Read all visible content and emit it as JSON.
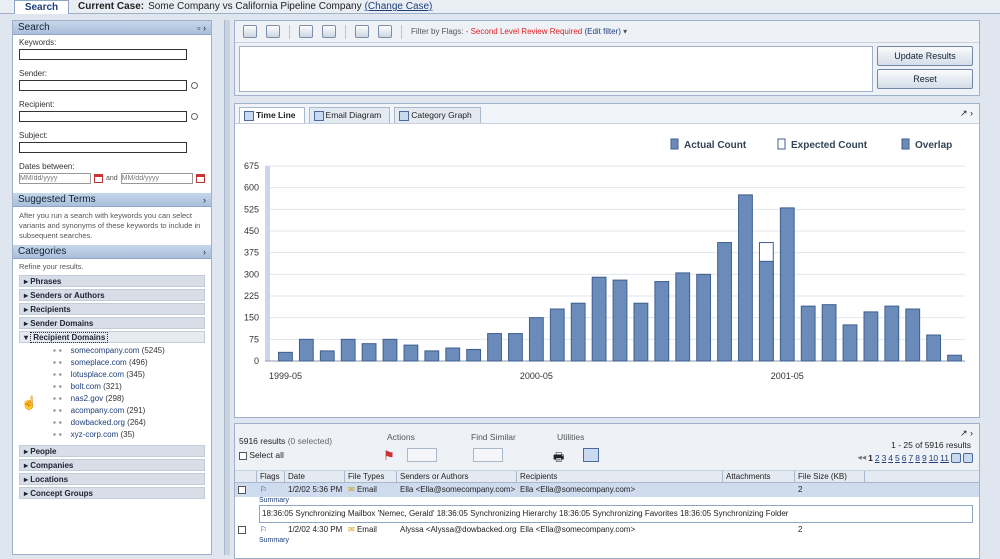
{
  "topbar": {
    "tab_search": "Search",
    "case_label": "Current Case:",
    "case_name": "Some Company vs California Pipeline Company",
    "change_case": "(Change Case)"
  },
  "search": {
    "title": "Search",
    "keywords_label": "Keywords:",
    "sender_label": "Sender:",
    "recipient_label": "Recipient:",
    "subject_label": "Subject:",
    "dates_label": "Dates between:",
    "date_placeholder": "MM/dd/yyyy",
    "and_label": "and"
  },
  "suggested": {
    "title": "Suggested Terms",
    "help": "After you run a search with keywords you can select variants and synonyms of these keywords to include in subsequent searches."
  },
  "categories": {
    "title": "Categories",
    "refine": "Refine your results.",
    "items": [
      "Phrases",
      "Senders or Authors",
      "Recipients",
      "Sender Domains",
      "Recipient Domains"
    ],
    "domains": [
      {
        "name": "somecompany.com",
        "count": "(5245)"
      },
      {
        "name": "someplace.com",
        "count": "(496)"
      },
      {
        "name": "lotusplace.com",
        "count": "(345)"
      },
      {
        "name": "bolt.com",
        "count": "(321)"
      },
      {
        "name": "nas2.gov",
        "count": "(298)"
      },
      {
        "name": "acompany.com",
        "count": "(291)"
      },
      {
        "name": "dowbacked.org",
        "count": "(264)"
      },
      {
        "name": "xyz-corp.com",
        "count": "(35)"
      }
    ],
    "bottom_items": [
      "People",
      "Companies",
      "Locations",
      "Concept Groups"
    ]
  },
  "toolbar": {
    "filter_label": "Filter by Flags:",
    "filter_value": "- Second Level Review Required",
    "edit_filter": "(Edit filter)",
    "update_button": "Update Results",
    "reset_button": "Reset"
  },
  "chart_tabs": [
    "Time Line",
    "Email Diagram",
    "Category Graph"
  ],
  "chart_data": {
    "type": "bar",
    "legend": [
      "Actual Count",
      "Expected Count",
      "Overlap"
    ],
    "legend_position": "top-right",
    "ylim": [
      0,
      675
    ],
    "yticks": [
      "675",
      "600",
      "525",
      "450",
      "375",
      "300",
      "225",
      "150",
      "75",
      "0"
    ],
    "xticks": [
      "1999-05",
      "2000-05",
      "2001-05"
    ],
    "grid": true,
    "values": [
      30,
      75,
      35,
      75,
      60,
      75,
      55,
      35,
      45,
      40,
      95,
      95,
      150,
      180,
      200,
      290,
      280,
      200,
      275,
      305,
      300,
      410,
      575,
      345,
      530,
      190,
      195,
      125,
      170,
      190,
      180,
      90,
      20
    ],
    "expected": [
      null,
      null,
      null,
      null,
      null,
      null,
      null,
      null,
      null,
      null,
      null,
      null,
      null,
      null,
      null,
      null,
      null,
      null,
      null,
      null,
      null,
      null,
      null,
      410,
      null,
      null,
      null,
      null,
      null,
      null,
      null,
      null,
      null
    ]
  },
  "results": {
    "count_text": "5916 results",
    "selected_text": "(0 selected)",
    "select_all": "Select all",
    "actions_label": "Actions",
    "find_similar_label": "Find Similar",
    "utilities_label": "Utilities",
    "range_text": "1 - 25 of 5916 results",
    "pages": [
      "1",
      "2",
      "3",
      "4",
      "5",
      "6",
      "7",
      "8",
      "9",
      "10",
      "11"
    ],
    "columns": [
      "Flags",
      "Date",
      "File Types",
      "Senders or Authors",
      "Recipients",
      "Attachments",
      "File Size (KB)"
    ],
    "rows": [
      {
        "date": "1/2/02 5:36 PM",
        "type": "Email",
        "sender": "Ella <Ella@somecompany.com>",
        "recipient": "Ella <Ella@somecompany.com>",
        "size": "2",
        "summary_label": "Summary",
        "summary": "18:36:05 Synchronizing Mailbox 'Nemec, Gerald' 18:36:05 Synchronizing Hierarchy 18:36:05 Synchronizing Favorites 18:36:05 Synchronizing Folder"
      },
      {
        "date": "1/2/02 4:30 PM",
        "type": "Email",
        "sender": "Alyssa <Alyssa@dowbacked.org>",
        "recipient": "Ella <Ella@somecompany.com>",
        "size": "2",
        "summary_label": "Summary"
      }
    ]
  },
  "colors": {
    "bar": "#6b8cba",
    "bar_edge": "#3e5f8e",
    "expected": "#ffffff",
    "grid": "#e1e6ee"
  }
}
